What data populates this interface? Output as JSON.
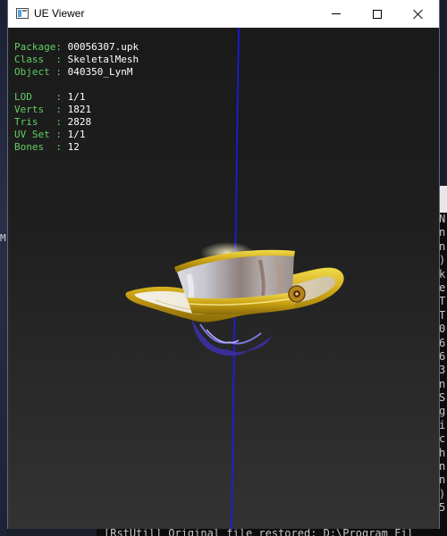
{
  "window": {
    "title": "UE Viewer",
    "buttons": {
      "minimize": "minimize-icon",
      "maximize": "maximize-icon",
      "close": "close-icon"
    }
  },
  "info": {
    "package": {
      "key": "Package:",
      "value": "00056307.upk"
    },
    "class": {
      "key": "Class  :",
      "value": "SkeletalMesh"
    },
    "object": {
      "key": "Object :",
      "value": "040350_LynM"
    },
    "lod": {
      "key": "LOD    :",
      "value": "1/1"
    },
    "verts": {
      "key": "Verts  :",
      "value": "1821"
    },
    "tris": {
      "key": "Tris   :",
      "value": "2828"
    },
    "uvset": {
      "key": "UV Set :",
      "value": "1/1"
    },
    "bones": {
      "key": "Bones  :",
      "value": "12"
    }
  },
  "background": {
    "left_char": "M",
    "console_chars": [
      "N",
      "n",
      "n",
      ")",
      "k",
      "e",
      "T",
      "T",
      "0",
      "6",
      "6",
      "3",
      "n",
      "S",
      "g",
      "i",
      "c",
      "h",
      "n",
      "n",
      ")",
      "5"
    ],
    "console_bottom_line": "[RstUtil] Original file restored: D:\\Program Fil"
  },
  "colors": {
    "label_green": "#60d060",
    "value_white": "#ffffff",
    "axis_blue": "#1a1aff",
    "hat_gold": "#d4b21a",
    "hat_silver": "#b9b9c2"
  }
}
